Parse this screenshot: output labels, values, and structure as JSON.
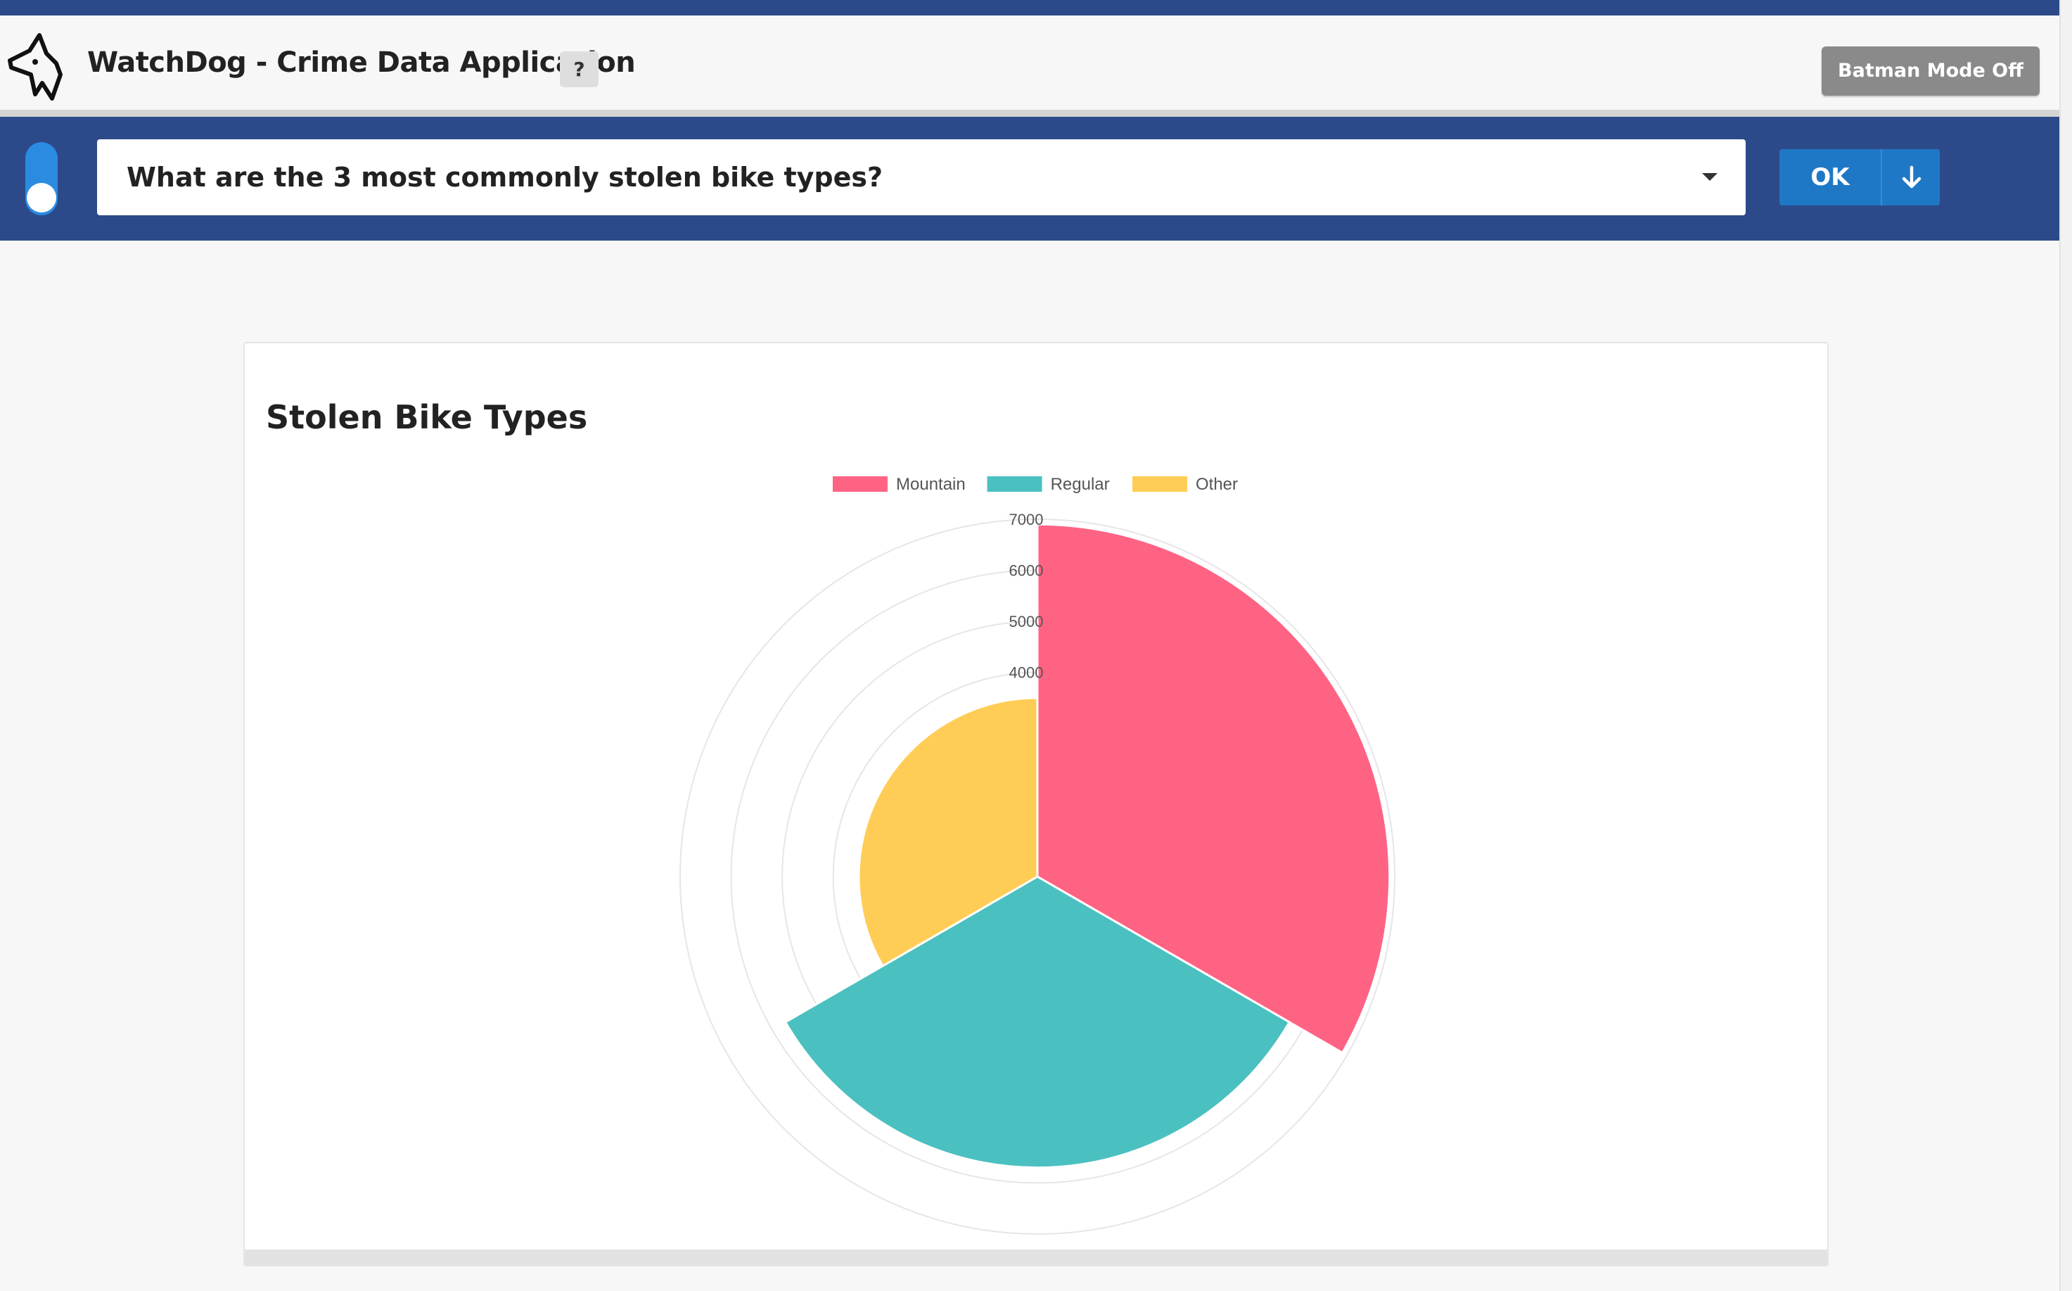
{
  "header": {
    "title": "WatchDog - Crime Data Application",
    "help_label": "?",
    "batman_label": "Batman Mode Off",
    "logo_icon": "dog-head-icon"
  },
  "query": {
    "text": "What are the 3 most commonly stolen bike types?",
    "ok_label": "OK",
    "toggle_on": true,
    "download_icon": "arrow-down-icon"
  },
  "colors": {
    "brand": "#2c4a8a",
    "primary_button": "#1f78c6",
    "mountain": "#ff6384",
    "regular": "#4bc0c0",
    "other": "#ffcd56"
  },
  "chart_data": {
    "type": "polarArea",
    "title": "Stolen Bike Types",
    "categories": [
      "Mountain",
      "Regular",
      "Other"
    ],
    "values": [
      6900,
      5700,
      3500
    ],
    "colors": [
      "#ff6384",
      "#4bc0c0",
      "#ffcd56"
    ],
    "scale": {
      "max": 7000,
      "ticks": [
        "7000",
        "6000",
        "5000",
        "4000"
      ]
    },
    "legend": "top",
    "grid": true
  }
}
